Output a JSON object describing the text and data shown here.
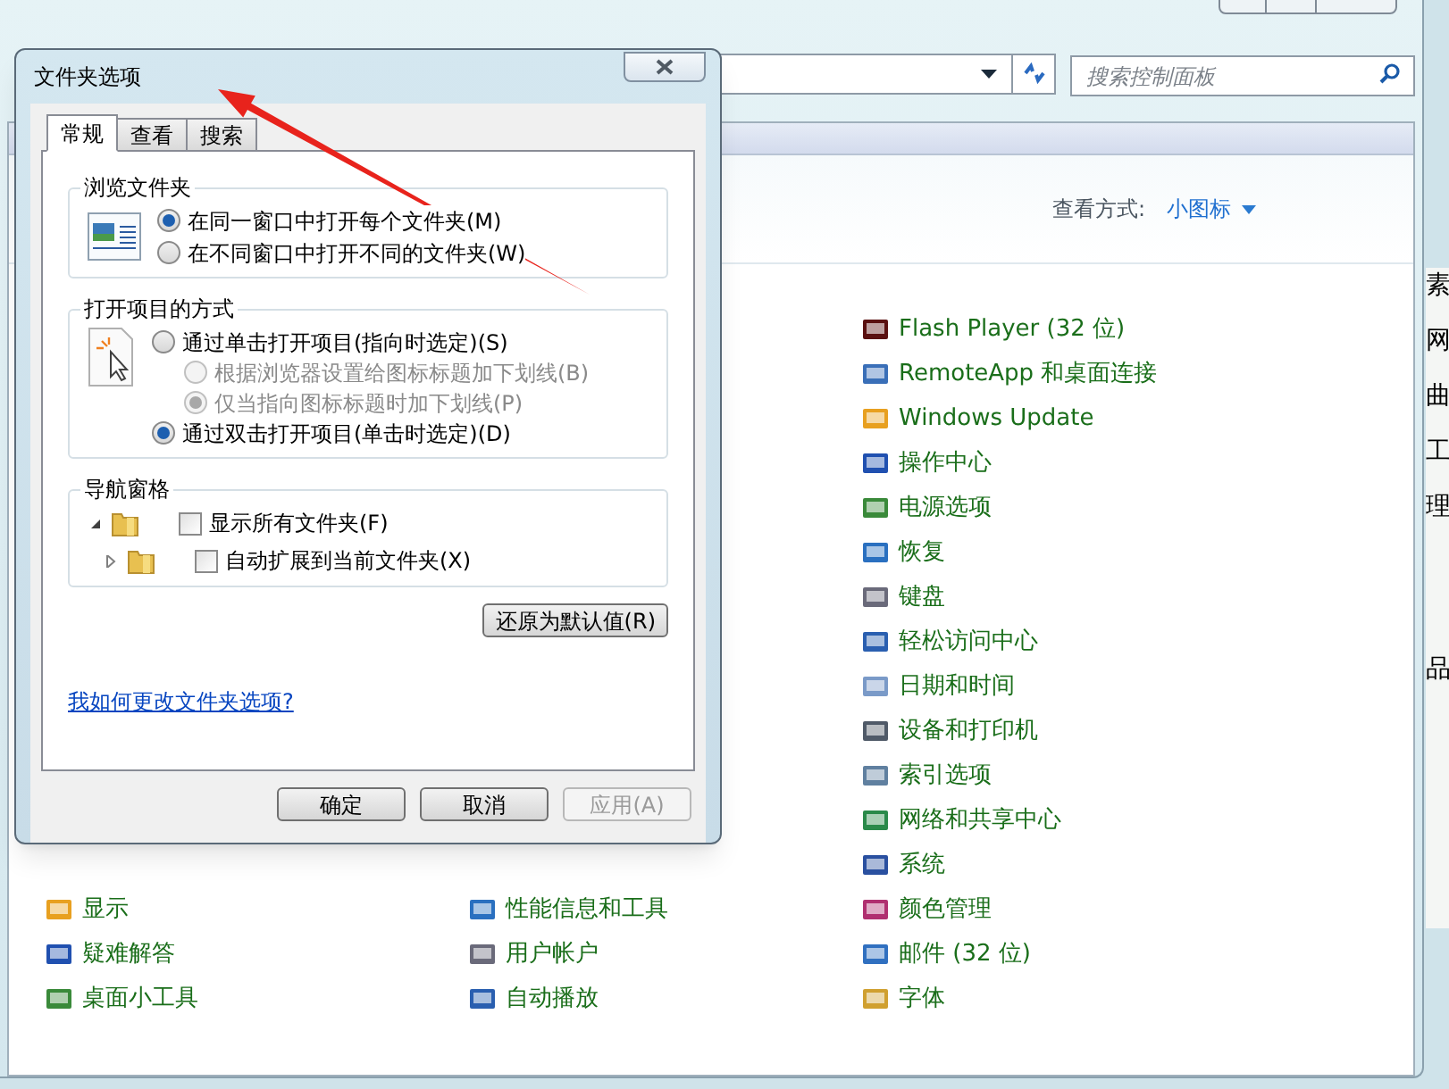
{
  "explorer": {
    "search": {
      "placeholder": "搜索控制面板"
    },
    "view_by": {
      "label": "查看方式:",
      "value": "小图标"
    },
    "items_left": [
      "显示",
      "疑难解答",
      "桌面小工具"
    ],
    "items_middle": [
      "性能信息和工具",
      "用户帐户",
      "自动播放"
    ],
    "items_right": [
      "Flash Player (32 位)",
      "RemoteApp 和桌面连接",
      "Windows Update",
      "操作中心",
      "电源选项",
      "恢复",
      "键盘",
      "轻松访问中心",
      "日期和时间",
      "设备和打印机",
      "索引选项",
      "网络和共享中心",
      "系统",
      "颜色管理",
      "邮件 (32 位)",
      "字体"
    ]
  },
  "behind_window_text": [
    "素",
    "网",
    "曲",
    "工",
    "理",
    "品"
  ],
  "dialog": {
    "title": "文件夹选项",
    "tabs": [
      {
        "label": "常规",
        "selected": true
      },
      {
        "label": "查看",
        "selected": false
      },
      {
        "label": "搜索",
        "selected": false
      }
    ],
    "browse_group": {
      "title": "浏览文件夹",
      "options": [
        {
          "label": "在同一窗口中打开每个文件夹(M)",
          "selected": true
        },
        {
          "label": "在不同窗口中打开不同的文件夹(W)",
          "selected": false
        }
      ]
    },
    "open_group": {
      "title": "打开项目的方式",
      "options": [
        {
          "label": "通过单击打开项目(指向时选定)(S)",
          "selected": false,
          "disabled": false,
          "children": [
            {
              "label": "根据浏览器设置给图标标题加下划线(B)",
              "selected": false,
              "disabled": true
            },
            {
              "label": "仅当指向图标标题时加下划线(P)",
              "selected": true,
              "disabled": true
            }
          ]
        },
        {
          "label": "通过双击打开项目(单击时选定)(D)",
          "selected": true,
          "disabled": false
        }
      ]
    },
    "nav_group": {
      "title": "导航窗格",
      "options": [
        {
          "label": "显示所有文件夹(F)",
          "checked": false,
          "expanded": true
        },
        {
          "label": "自动扩展到当前文件夹(X)",
          "checked": false,
          "expanded": false
        }
      ]
    },
    "restore_button": "还原为默认值(R)",
    "help_link": "我如何更改文件夹选项?",
    "buttons": [
      {
        "label": "确定",
        "disabled": false
      },
      {
        "label": "取消",
        "disabled": false
      },
      {
        "label": "应用(A)",
        "disabled": true
      }
    ]
  }
}
